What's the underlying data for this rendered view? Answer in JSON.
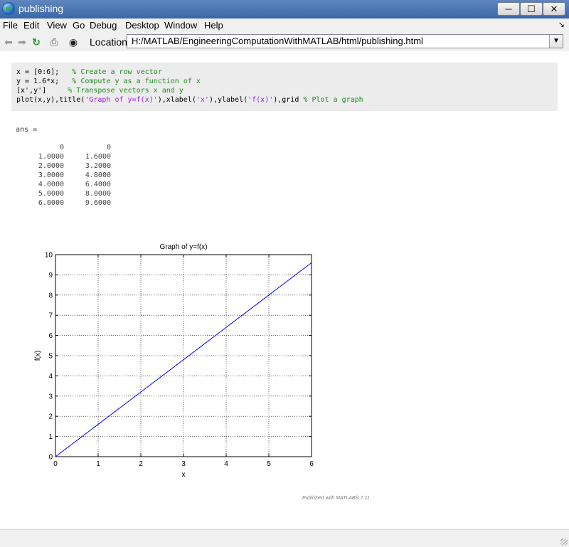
{
  "window": {
    "title": "publishing"
  },
  "menu": [
    "File",
    "Edit",
    "View",
    "Go",
    "Debug",
    "Desktop",
    "Window",
    "Help"
  ],
  "toolbar": {
    "location_label": "Location:",
    "location_value": "H:/MATLAB/EngineeringComputationWithMATLAB/html/publishing.html"
  },
  "code": {
    "line1_code": "x = [0:6];   ",
    "line1_comment": "% Create a row vector",
    "line2_code": "y = 1.6*x;   ",
    "line2_comment": "% Compute y as a function of x",
    "line3_code": "[x',y']     ",
    "line3_comment": "% Transpose vectors x and y",
    "line4_a": "plot(x,y),title(",
    "line4_s1": "'Graph of y=f(x)'",
    "line4_b": "),xlabel(",
    "line4_s2": "'x'",
    "line4_c": "),ylabel(",
    "line4_s3": "'f(x)'",
    "line4_d": "),grid ",
    "line4_comment": "% Plot a graph"
  },
  "output": {
    "ans_label": "ans =",
    "rows": [
      [
        "0",
        "0"
      ],
      [
        "1.0000",
        "1.6000"
      ],
      [
        "2.0000",
        "3.2000"
      ],
      [
        "3.0000",
        "4.8000"
      ],
      [
        "4.0000",
        "6.4000"
      ],
      [
        "5.0000",
        "8.0000"
      ],
      [
        "6.0000",
        "9.6000"
      ]
    ]
  },
  "chart_data": {
    "type": "line",
    "title": "Graph of y=f(x)",
    "xlabel": "x",
    "ylabel": "f(x)",
    "xlim": [
      0,
      6
    ],
    "ylim": [
      0,
      10
    ],
    "xticks": [
      0,
      1,
      2,
      3,
      4,
      5,
      6
    ],
    "yticks": [
      0,
      1,
      2,
      3,
      4,
      5,
      6,
      7,
      8,
      9,
      10
    ],
    "grid": true,
    "series": [
      {
        "x": [
          0,
          1,
          2,
          3,
          4,
          5,
          6
        ],
        "y": [
          0,
          1.6,
          3.2,
          4.8,
          6.4,
          8.0,
          9.6
        ],
        "color": "#0000ff"
      }
    ]
  },
  "footer": {
    "published_with": "Published with MATLAB® 7.11"
  }
}
